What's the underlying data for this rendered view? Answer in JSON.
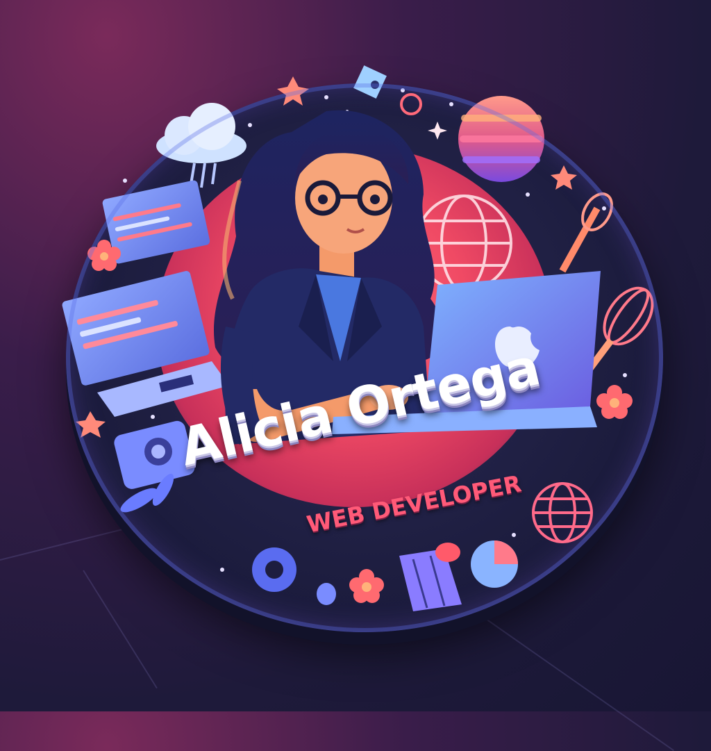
{
  "badge": {
    "name": "Alicia Ortega",
    "role": "WEB DEVELOPER"
  },
  "colors": {
    "background": "#1e1a3a",
    "badge": "#1d1d3f",
    "glow": "#f04a64",
    "accent_pink": "#ff5a78",
    "accent_blue": "#6a8cff",
    "name_text": "#ffffff"
  },
  "icons": [
    "cloud-icon",
    "globe-icon",
    "planet-icon",
    "laptop-icon",
    "browser-window-icon",
    "whisk-icon",
    "flower-icon",
    "star-icon",
    "camera-icon",
    "leaf-icon",
    "donut-icon",
    "pie-icon"
  ]
}
